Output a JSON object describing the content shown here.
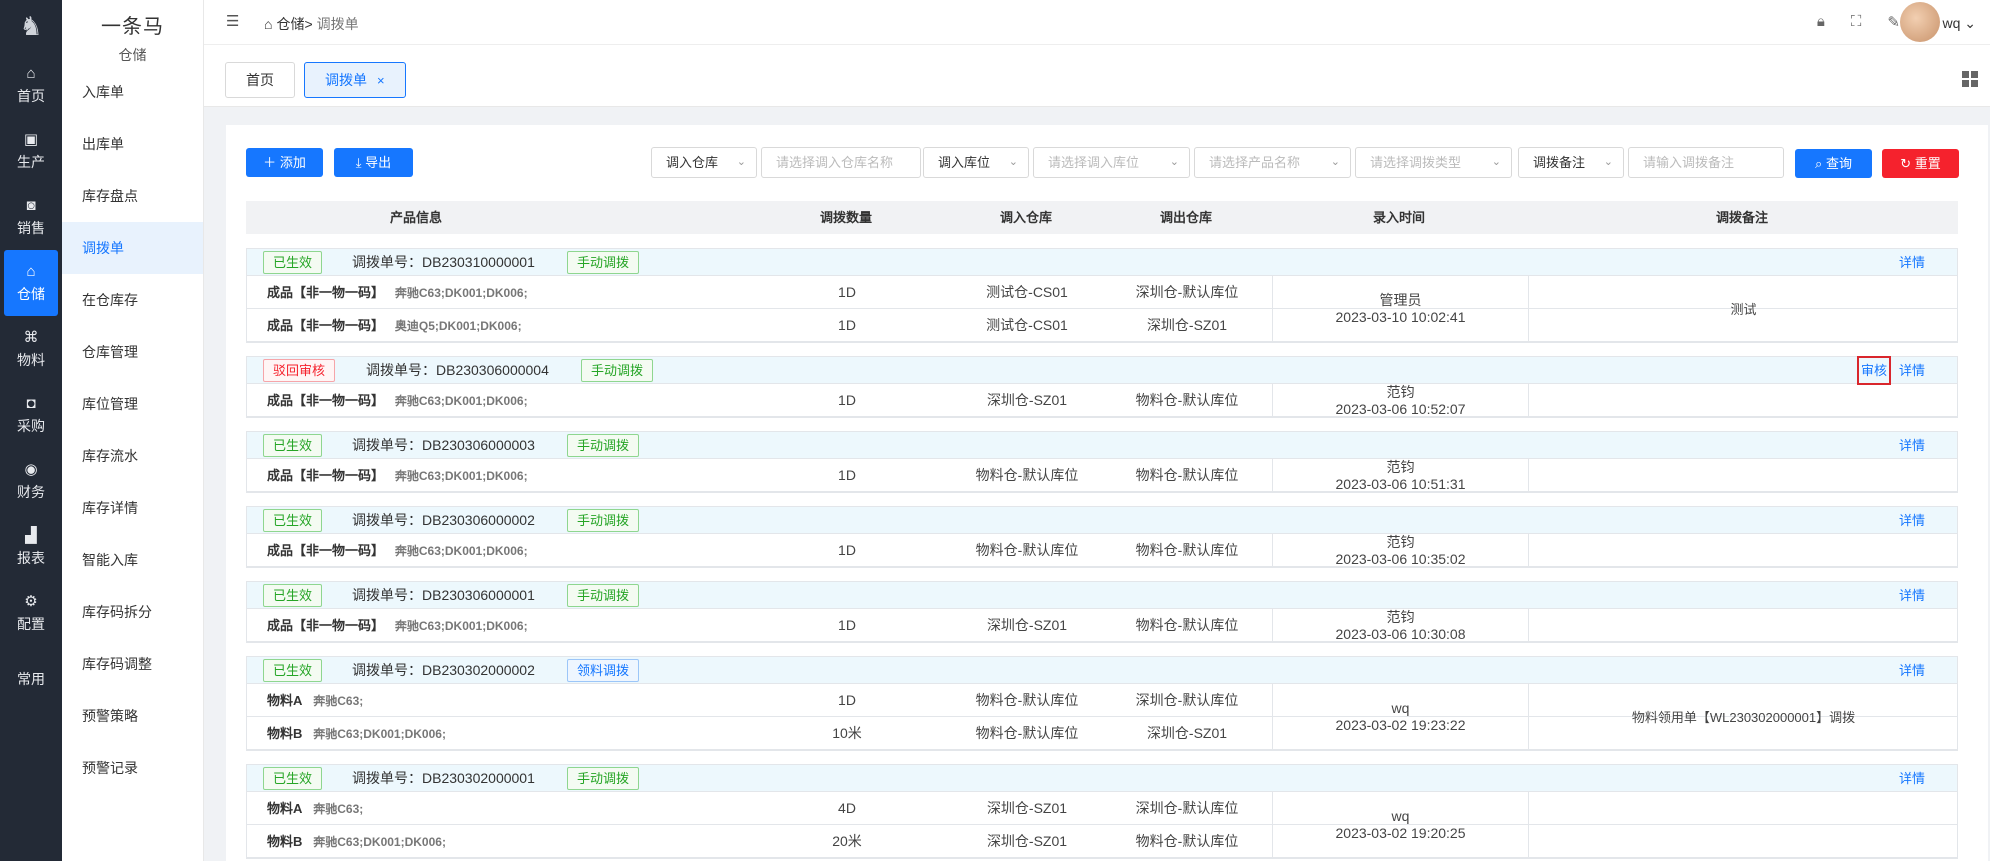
{
  "rail": {
    "items": [
      {
        "label": "首页",
        "icon": "home-icon",
        "glyph": "⌂"
      },
      {
        "label": "生产",
        "icon": "factory-icon",
        "glyph": "▣"
      },
      {
        "label": "销售",
        "icon": "sales-icon",
        "glyph": "◙"
      },
      {
        "label": "仓储",
        "icon": "warehouse-icon",
        "glyph": "⌂"
      },
      {
        "label": "物料",
        "icon": "material-icon",
        "glyph": "⌘"
      },
      {
        "label": "采购",
        "icon": "purchase-icon",
        "glyph": "◘"
      },
      {
        "label": "财务",
        "icon": "finance-icon",
        "glyph": "◉"
      },
      {
        "label": "报表",
        "icon": "report-icon",
        "glyph": "▟"
      },
      {
        "label": "配置",
        "icon": "config-icon",
        "glyph": "⚙"
      },
      {
        "label": "常用",
        "icon": "",
        "glyph": ""
      }
    ],
    "active_index": 3
  },
  "sidebar": {
    "brand": "一条马",
    "section": "仓储",
    "items": [
      "入库单",
      "出库单",
      "库存盘点",
      "调拨单",
      "在仓库存",
      "仓库管理",
      "库位管理",
      "库存流水",
      "库存详情",
      "智能入库",
      "库存码拆分",
      "库存码调整",
      "预警策略",
      "预警记录"
    ],
    "active_index": 3
  },
  "header": {
    "crumb_root": "仓储>",
    "crumb_current": "调拨单",
    "user": "wq"
  },
  "tabs": [
    {
      "label": "首页"
    },
    {
      "label": "调拨单",
      "close": "×"
    }
  ],
  "toolbar": {
    "add_label": "添加",
    "export_label": "导出",
    "search_label": "查询",
    "reset_label": "重置",
    "filters": {
      "in_warehouse_label": "调入仓库",
      "in_warehouse_ph": "请选择调入仓库名称",
      "in_location_label": "调入库位",
      "in_location_ph": "请选择调入库位",
      "product_ph": "请选择产品名称",
      "type_ph": "请选择调拨类型",
      "remark_label": "调拨备注",
      "remark_ph": "请输入调拨备注"
    }
  },
  "table": {
    "columns": {
      "product": "产品信息",
      "qty": "调拨数量",
      "in_wh": "调入仓库",
      "out_wh": "调出仓库",
      "time": "录入时间",
      "remark": "调拨备注"
    },
    "order_prefix": "调拨单号：",
    "detail_label": "详情",
    "audit_label": "审核",
    "groups": [
      {
        "status": "已生效",
        "status_kind": "ok",
        "order_no": "DB230310000001",
        "type": "手动调拨",
        "type_kind": "manual",
        "user": "管理员",
        "time": "2023-03-10 10:02:41",
        "remark": "测试",
        "audit": false,
        "rows": [
          {
            "ptype": "成品【非一物一码】",
            "spec": "奔驰C63;DK001;DK006;",
            "qty": "1D",
            "in_wh": "测试仓-CS01",
            "out_wh": "深圳仓-默认库位"
          },
          {
            "ptype": "成品【非一物一码】",
            "spec": "奥迪Q5;DK001;DK006;",
            "qty": "1D",
            "in_wh": "测试仓-CS01",
            "out_wh": "深圳仓-SZ01"
          }
        ]
      },
      {
        "status": "驳回审核",
        "status_kind": "bad",
        "order_no": "DB230306000004",
        "type": "手动调拨",
        "type_kind": "manual",
        "user": "范钧",
        "time": "2023-03-06 10:52:07",
        "remark": "",
        "audit": true,
        "rows": [
          {
            "ptype": "成品【非一物一码】",
            "spec": "奔驰C63;DK001;DK006;",
            "qty": "1D",
            "in_wh": "深圳仓-SZ01",
            "out_wh": "物料仓-默认库位"
          }
        ]
      },
      {
        "status": "已生效",
        "status_kind": "ok",
        "order_no": "DB230306000003",
        "type": "手动调拨",
        "type_kind": "manual",
        "user": "范钧",
        "time": "2023-03-06 10:51:31",
        "remark": "",
        "audit": false,
        "rows": [
          {
            "ptype": "成品【非一物一码】",
            "spec": "奔驰C63;DK001;DK006;",
            "qty": "1D",
            "in_wh": "物料仓-默认库位",
            "out_wh": "物料仓-默认库位"
          }
        ]
      },
      {
        "status": "已生效",
        "status_kind": "ok",
        "order_no": "DB230306000002",
        "type": "手动调拨",
        "type_kind": "manual",
        "user": "范钧",
        "time": "2023-03-06 10:35:02",
        "remark": "",
        "audit": false,
        "rows": [
          {
            "ptype": "成品【非一物一码】",
            "spec": "奔驰C63;DK001;DK006;",
            "qty": "1D",
            "in_wh": "物料仓-默认库位",
            "out_wh": "物料仓-默认库位"
          }
        ]
      },
      {
        "status": "已生效",
        "status_kind": "ok",
        "order_no": "DB230306000001",
        "type": "手动调拨",
        "type_kind": "manual",
        "user": "范钧",
        "time": "2023-03-06 10:30:08",
        "remark": "",
        "audit": false,
        "rows": [
          {
            "ptype": "成品【非一物一码】",
            "spec": "奔驰C63;DK001;DK006;",
            "qty": "1D",
            "in_wh": "深圳仓-SZ01",
            "out_wh": "物料仓-默认库位"
          }
        ]
      },
      {
        "status": "已生效",
        "status_kind": "ok",
        "order_no": "DB230302000002",
        "type": "领料调拨",
        "type_kind": "pick",
        "user": "wq",
        "time": "2023-03-02 19:23:22",
        "remark": "物料领用单【WL230302000001】调拨",
        "audit": false,
        "rows": [
          {
            "ptype": "物料A",
            "spec": "奔驰C63;",
            "qty": "1D",
            "in_wh": "物料仓-默认库位",
            "out_wh": "深圳仓-默认库位"
          },
          {
            "ptype": "物料B",
            "spec": "奔驰C63;DK001;DK006;",
            "qty": "10米",
            "in_wh": "物料仓-默认库位",
            "out_wh": "深圳仓-SZ01"
          }
        ]
      },
      {
        "status": "已生效",
        "status_kind": "ok",
        "order_no": "DB230302000001",
        "type": "手动调拨",
        "type_kind": "manual",
        "user": "wq",
        "time": "2023-03-02 19:20:25",
        "remark": "",
        "audit": false,
        "rows": [
          {
            "ptype": "物料A",
            "spec": "奔驰C63;",
            "qty": "4D",
            "in_wh": "深圳仓-SZ01",
            "out_wh": "深圳仓-默认库位"
          },
          {
            "ptype": "物料B",
            "spec": "奔驰C63;DK001;DK006;",
            "qty": "20米",
            "in_wh": "深圳仓-SZ01",
            "out_wh": "物料仓-默认库位"
          }
        ]
      }
    ]
  }
}
